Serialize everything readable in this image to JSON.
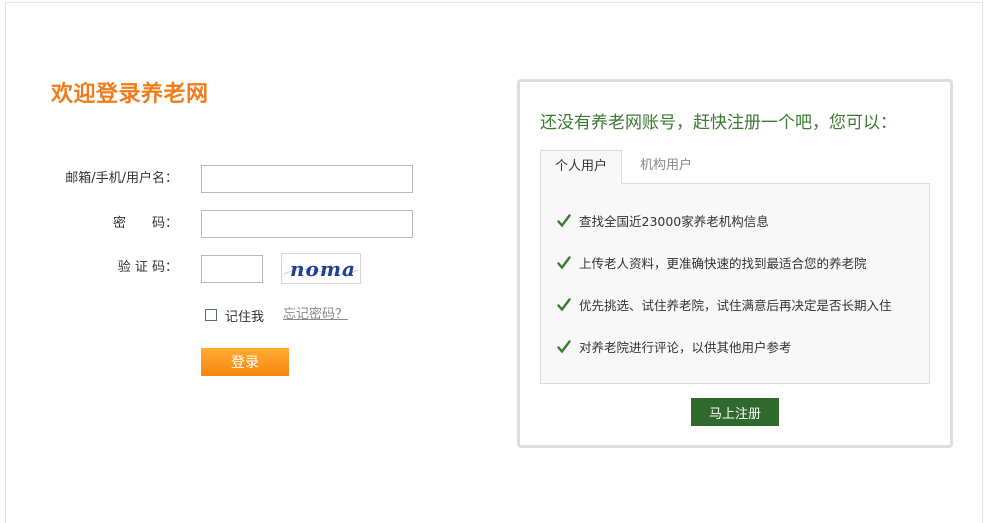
{
  "login": {
    "title": "欢迎登录养老网",
    "username_label": "邮箱/手机/用户名：",
    "password_label": "密　　码：",
    "captcha_label": "验 证 码：",
    "username_value": "",
    "password_value": "",
    "captcha_value": "",
    "captcha_text": "noma",
    "remember_label": "记住我",
    "forgot_label": "忘记密码？",
    "login_button": "登录"
  },
  "register": {
    "title": "还没有养老网账号，赶快注册一个吧，您可以：",
    "tabs": [
      {
        "label": "个人用户",
        "active": true
      },
      {
        "label": "机构用户",
        "active": false
      }
    ],
    "benefits": [
      "查找全国近23000家养老机构信息",
      "上传老人资料，更准确快速的找到最适合您的养老院",
      "优先挑选、试住养老院，试住满意后再决定是否长期入住",
      "对养老院进行评论，以供其他用户参考"
    ],
    "register_button": "马上注册"
  },
  "colors": {
    "brand_orange": "#f07d1c",
    "brand_green": "#3d7a33",
    "button_green": "#2f6a2c"
  }
}
